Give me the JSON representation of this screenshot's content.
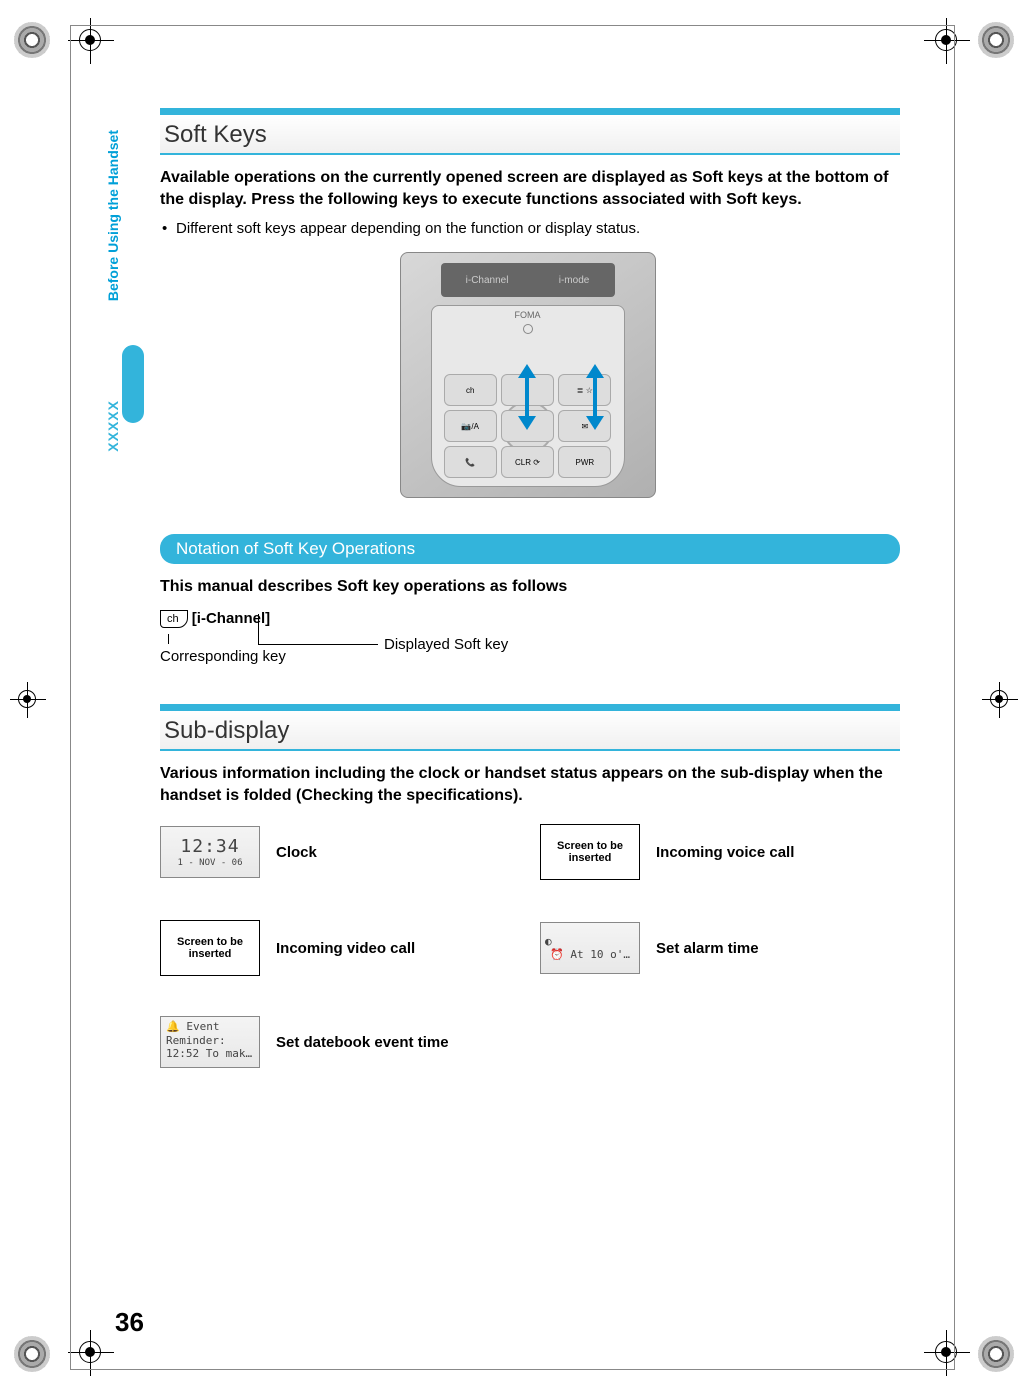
{
  "side": {
    "chapter": "Before Using the Handset",
    "marker": "XXXXX"
  },
  "section1": {
    "title": "Soft Keys",
    "intro": "Available operations on the currently opened screen are displayed as Soft keys at the bottom of the display. Press the following keys to execute functions associated with Soft keys.",
    "bullet": "Different soft keys appear depending on the function or display status.",
    "phone_screen_left": "i-Channel",
    "phone_screen_right": "i-mode",
    "phone_brand": "FOMA"
  },
  "notation": {
    "heading": "Notation of Soft Key Operations",
    "intro": "This manual describes Soft key operations as follows",
    "key_char": "ch",
    "key_label": "[i-Channel]",
    "leader1": "Corresponding key",
    "leader2": "Displayed Soft key"
  },
  "section2": {
    "title": "Sub-display",
    "intro": "Various information including the clock or handset status appears on the sub-display when the handset is folded  (Checking the specifications)."
  },
  "sub_display": {
    "placeholder": "Screen to be inserted",
    "clock_time": "12:34",
    "clock_date": "1 - NOV - 06",
    "alarm_text": "At 10 o'…",
    "event_line1": "Event",
    "event_line2": "Reminder:",
    "event_line3": "12:52 To mak…",
    "labels": {
      "clock": "Clock",
      "voice": "Incoming voice call",
      "video": "Incoming video call",
      "alarm": "Set alarm time",
      "datebook": "Set datebook event time"
    }
  },
  "page_number": "36"
}
